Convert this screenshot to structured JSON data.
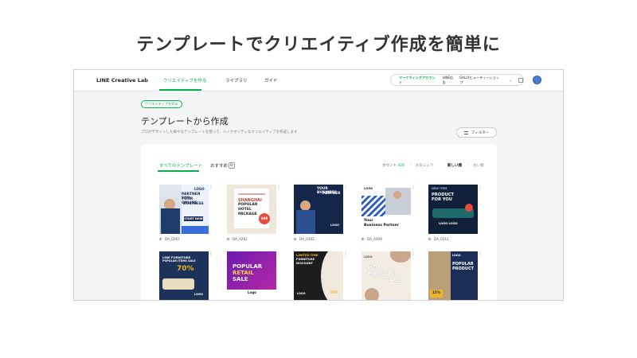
{
  "slide_title": "テンプレートでクリエイティブ作成を簡単に",
  "nav": {
    "logo": "LINE Creative Lab",
    "links": [
      "クリエイティブを作る",
      "ライブラリ",
      "ガイド"
    ],
    "account_tag": "マーケティングアカウント",
    "account_name": "LINE広告",
    "shop_name": "SALLYビューティーショップ",
    "caret": "⌄"
  },
  "breadcrumb": "クリエイティブを作る",
  "breadcrumb_sep": "›",
  "page_title": "テンプレートから作成",
  "page_subtitle": "プロがデザインした様々なテンプレートを使って、ハイクオリティなクリエイティブを作成します",
  "filter_label": "フィルター",
  "tabs": [
    "すべてのテンプレート",
    "おすすめ"
  ],
  "count_label": "カウント",
  "count_value": "426",
  "sort": [
    "お気に入り",
    "新しい順",
    "古い順"
  ],
  "cards": [
    {
      "id": "DA_0267",
      "lines": [
        "LOGO",
        "PARTNER FOR",
        "YOUR ONLINE",
        "BUSINESS"
      ],
      "btn": "START NOW"
    },
    {
      "id": "DA_0262",
      "lines": [
        "SHANGHAI",
        "POPULAR",
        "HOTEL",
        "PACKAGE"
      ],
      "badge": "$99"
    },
    {
      "id": "DA_0302",
      "lines": [
        "YOUR BUSINESS",
        "PARTNER"
      ],
      "logo": "LOGO"
    },
    {
      "id": "DA_0309",
      "lines": [
        "LOGO",
        "Your",
        "Business Partner"
      ]
    },
    {
      "id": "DA_0311",
      "lines": [
        "NEW ITEM",
        "PRODUCT",
        "FOR YOU"
      ],
      "logo": "LOGO LOGO"
    },
    {
      "id": "",
      "lines": [
        "LINE FURNITURE",
        "POPULAR ITEMS SALE",
        "70%"
      ],
      "logo": "LOGO"
    },
    {
      "id": "",
      "lines": [
        "POPULAR",
        "RETAIL",
        "SALE"
      ],
      "logo": "Logo"
    },
    {
      "id": "",
      "lines": [
        "LIMITED TIME",
        "FURNITURE",
        "DISCOUNT"
      ],
      "badge": "50%",
      "logo": "LOGO"
    },
    {
      "id": "",
      "lines": [
        "LOGO",
        "HOT",
        "PRODUCT",
        "SALE"
      ]
    },
    {
      "id": "",
      "lines": [
        "LOGO",
        "POPULAR",
        "PRODUCT"
      ],
      "badge": "15%"
    }
  ]
}
